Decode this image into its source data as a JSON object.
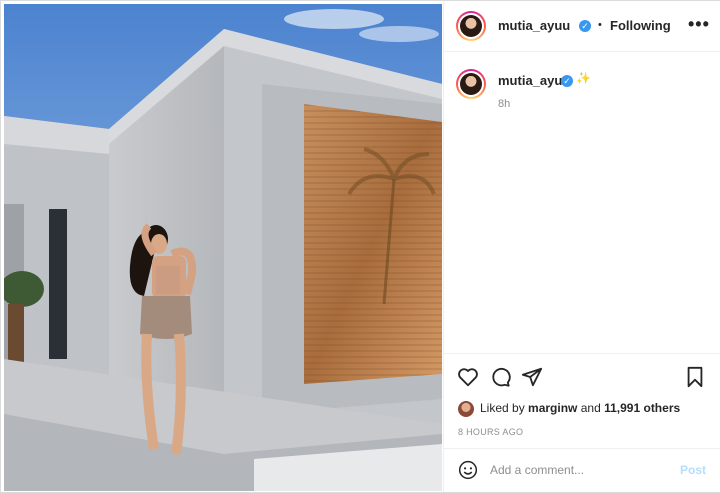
{
  "header": {
    "username": "mutia_ayuu",
    "separator": "•",
    "follow_status": "Following",
    "more_glyph": "•••"
  },
  "caption": {
    "username": "mutia_ayuu",
    "sparkle": "✨",
    "time": "8h"
  },
  "likes": {
    "prefix": "Liked by",
    "user": "marginw",
    "middle": "and",
    "count": "11,991 others"
  },
  "timestamp": "8 HOURS AGO",
  "comment": {
    "placeholder": "Add a comment...",
    "post_label": "Post"
  },
  "colors": {
    "verified": "#3897f0",
    "post_disabled": "#b2dffc"
  },
  "icons": [
    "heart-icon",
    "comment-icon",
    "share-icon",
    "bookmark-icon",
    "emoji-icon",
    "verified-icon",
    "more-icon"
  ]
}
